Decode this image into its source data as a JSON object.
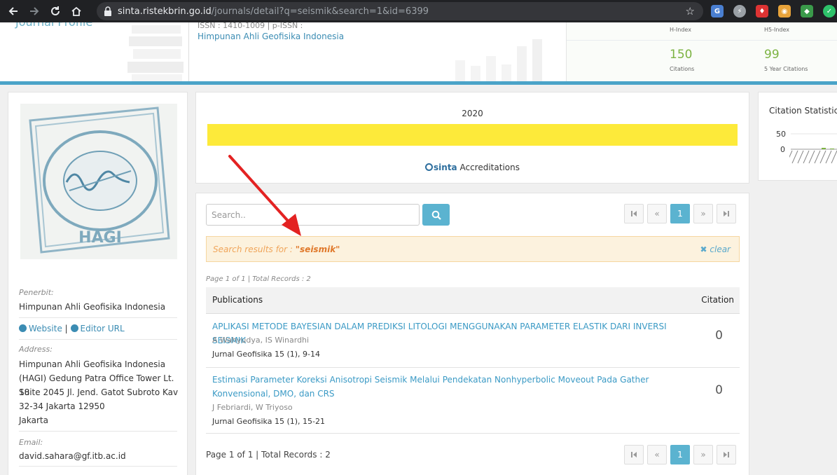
{
  "browser": {
    "url_host": "sinta.ristekbrin.go.id",
    "url_path": "/journals/detail?q=seismik&search=1&id=6399"
  },
  "header": {
    "title": "Journal Profile",
    "sub": "ISSN : 1410-1009 | p-ISSN :",
    "publisher": "Himpunan Ahli Geofisika Indonesia",
    "metrics": {
      "h_index_label": "H-Index",
      "h5_index_label": "H5-Index",
      "citations_value": "150",
      "citations_label": "Citations",
      "five_year_value": "99",
      "five_year_label": "5 Year Citations"
    }
  },
  "sidebar": {
    "publisher_label": "Penerbit:",
    "publisher": "Himpunan Ahli Geofisika Indonesia",
    "website": "Website",
    "separator": "|",
    "editor_url": "Editor URL",
    "address_label": "Address:",
    "address_lines": [
      "Himpunan Ahli Geofisika Indonesia",
      "(HAGI) Gedung Patra Office Tower Lt. 18",
      "Suite 2045 Jl. Jend. Gatot Subroto Kav",
      "32-34 Jakarta 12950",
      "Jakarta"
    ],
    "email_label": "Email:",
    "email": "david.sahara@gf.itb.ac.id"
  },
  "accreditation": {
    "year": "2020",
    "brand": "sinta",
    "caption": "Accreditations",
    "bar_color": "#fdea3a"
  },
  "citation_stats": {
    "title": "Citation Statistics",
    "tick_50": "50",
    "tick_0": "0"
  },
  "search": {
    "placeholder": "Search..",
    "value": ""
  },
  "pagination": {
    "first": "⏮",
    "prev": "«",
    "current": "1",
    "next": "»",
    "last": "⏭"
  },
  "alert": {
    "prefix": "Search results for :",
    "term": "\"seismik\"",
    "clear": "clear"
  },
  "records": {
    "top": "Page 1 of 1 | Total Records : 2",
    "bottom": "Page 1 of 1 | Total Records : 2"
  },
  "table": {
    "col_publications": "Publications",
    "col_citation": "Citation",
    "rows": [
      {
        "title": "APLIKASI METODE BAYESIAN DALAM PREDIKSI LITOLOGI MENGGUNAKAN PARAMETER ELASTIK DARI INVERSI SEISMIK",
        "authors": "A Wahyudya, IS Winardhi",
        "venue": "Jurnal Geofisika 15 (1), 9-14",
        "citations": "0"
      },
      {
        "title": "Estimasi Parameter Koreksi Anisotropi Seismik Melalui Pendekatan Nonhyperbolic Moveout Pada Gather Konvensional, DMO, dan CRS",
        "authors": "J Febriardi, W Triyoso",
        "venue": "Jurnal Geofisika 15 (1), 15-21",
        "citations": "0"
      }
    ]
  },
  "colors": {
    "accent": "#5bb3d0",
    "link": "#3b9ac5",
    "alert_bg": "#fcf2de",
    "metric_green": "#7cb342",
    "annotation_arrow": "#e32222"
  }
}
